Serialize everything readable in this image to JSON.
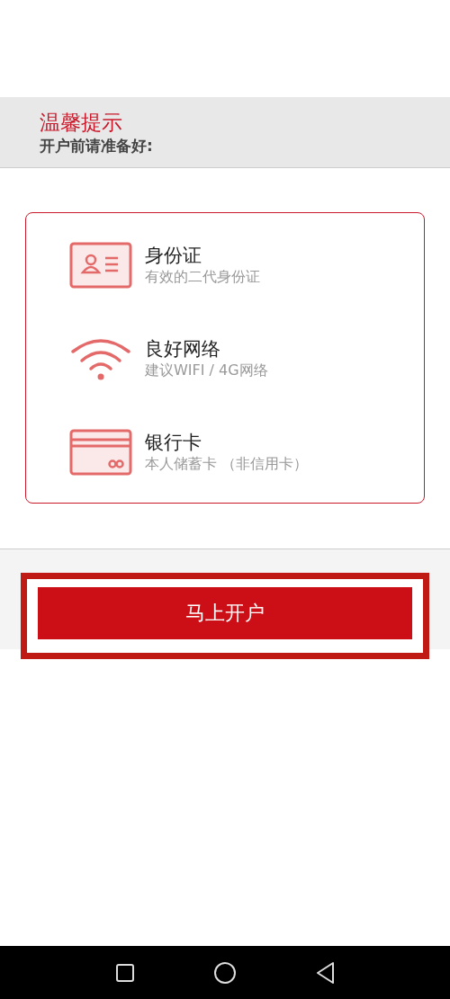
{
  "notice": {
    "title": "温馨提示",
    "subtitle": "开户前请准备好:"
  },
  "requirements": [
    {
      "kind": "id-card",
      "title": "身份证",
      "detail": "有效的二代身份证"
    },
    {
      "kind": "network",
      "title": "良好网络",
      "detail": "建议WIFI / 4G网络"
    },
    {
      "kind": "bank-card",
      "title": "银行卡",
      "detail": "本人储蓄卡 （非信用卡）"
    }
  ],
  "button": {
    "label": "马上开户"
  }
}
